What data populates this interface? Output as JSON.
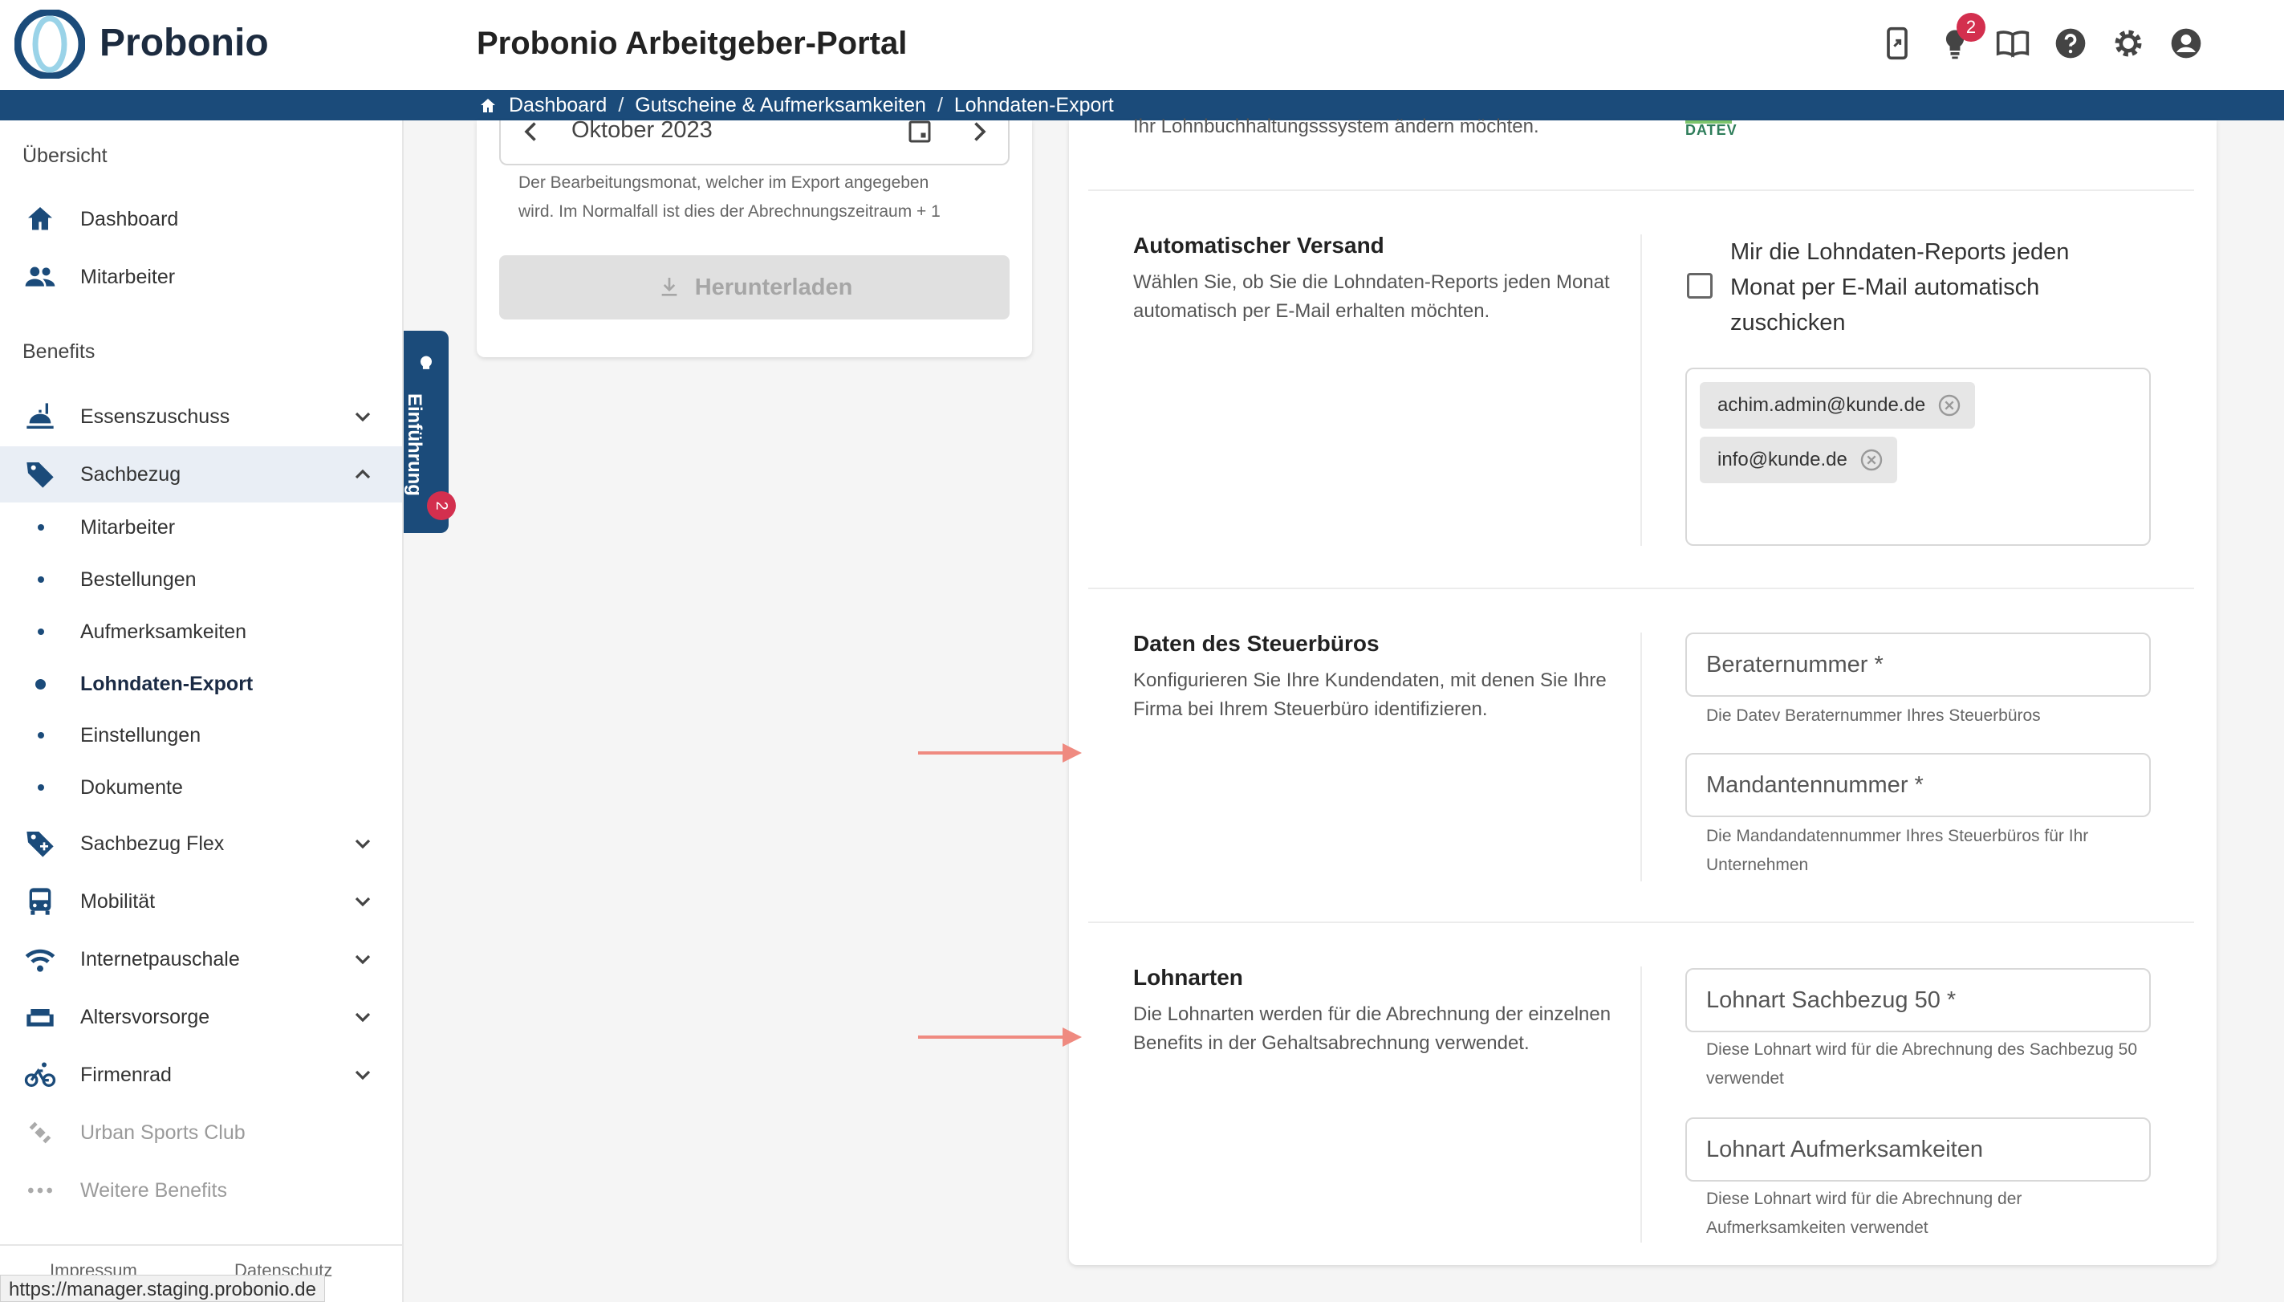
{
  "app": {
    "logo_text": "Probonio",
    "title": "Probonio Arbeitgeber-Portal"
  },
  "header_icons": [
    {
      "name": "mobile-app-icon"
    },
    {
      "name": "lightbulb-icon",
      "badge": "2"
    },
    {
      "name": "book-icon"
    },
    {
      "name": "help-icon"
    },
    {
      "name": "settings-icon"
    },
    {
      "name": "account-icon"
    }
  ],
  "breadcrumb": [
    "Dashboard",
    "Gutscheine & Aufmerksamkeiten",
    "Lohndaten-Export"
  ],
  "sidebar": {
    "section_overview": "Übersicht",
    "overview_items": [
      {
        "label": "Dashboard",
        "icon": "home-icon"
      },
      {
        "label": "Mitarbeiter",
        "icon": "people-icon"
      }
    ],
    "section_benefits": "Benefits",
    "essenszuschuss": "Essenszuschuss",
    "sachbezug": "Sachbezug",
    "sachbezug_sub": [
      "Mitarbeiter",
      "Bestellungen",
      "Aufmerksamkeiten",
      "Lohndaten-Export",
      "Einstellungen",
      "Dokumente"
    ],
    "sachbezug_flex": "Sachbezug Flex",
    "mobilitaet": "Mobilität",
    "internetpauschale": "Internetpauschale",
    "altersvorsorge": "Altersvorsorge",
    "firmenrad": "Firmenrad",
    "urban_sports": "Urban Sports Club",
    "weitere": "Weitere Benefits",
    "footer": [
      "Impressum",
      "Datenschutz"
    ]
  },
  "status_url": "https://manager.staging.probonio.de",
  "intro_tab": {
    "label": "Einführung",
    "badge": "2"
  },
  "export_card": {
    "month": "Oktober 2023",
    "helper_1": "Der Bearbeitungsmonat, welcher im Export angegeben",
    "helper_2": "wird. Im Normalfall ist dies der Abrechnungszeitraum + 1",
    "download_label": "Herunterladen"
  },
  "settings": {
    "cut_text": "Ihr Lohnbuchhaltungsssystem ändern möchten.",
    "datev_logo": "DATEV",
    "auto": {
      "title": "Automatischer Versand",
      "desc": "Wählen Sie, ob Sie die Lohndaten-Reports jeden Monat automatisch per E-Mail erhalten möchten.",
      "checkbox_label": "Mir die Lohndaten-Reports jeden Monat per E-Mail automatisch zuschicken",
      "checked": false,
      "emails": [
        "achim.admin@kunde.de",
        "info@kunde.de"
      ]
    },
    "steuer": {
      "title": "Daten des Steuerbüros",
      "desc": "Konfigurieren Sie Ihre Kundendaten, mit denen Sie Ihre Firma bei Ihrem Steuerbüro identifizieren.",
      "berater_label": "Beraternummer *",
      "berater_hint": "Die Datev Beraternummer Ihres Steuerbüros",
      "mandant_label": "Mandantennummer *",
      "mandant_hint": "Die Mandandatennummer Ihres Steuerbüros für Ihr Unternehmen"
    },
    "lohnarten": {
      "title": "Lohnarten",
      "desc": "Die Lohnarten werden für die Abrechnung der einzelnen Benefits in der Gehaltsabrechnung verwendet.",
      "sachbezug_label": "Lohnart Sachbezug 50 *",
      "sachbezug_hint": "Diese Lohnart wird für die Abrechnung des Sachbezug 50 verwendet",
      "aufmerk_label": "Lohnart Aufmerksamkeiten",
      "aufmerk_hint": "Diese Lohnart wird für die Abrechnung der Aufmerksamkeiten verwendet"
    }
  },
  "colors": {
    "brand_blue": "#1b4b7a",
    "badge_red": "#d32f4e",
    "annotation_arrow": "#ef8a80"
  }
}
